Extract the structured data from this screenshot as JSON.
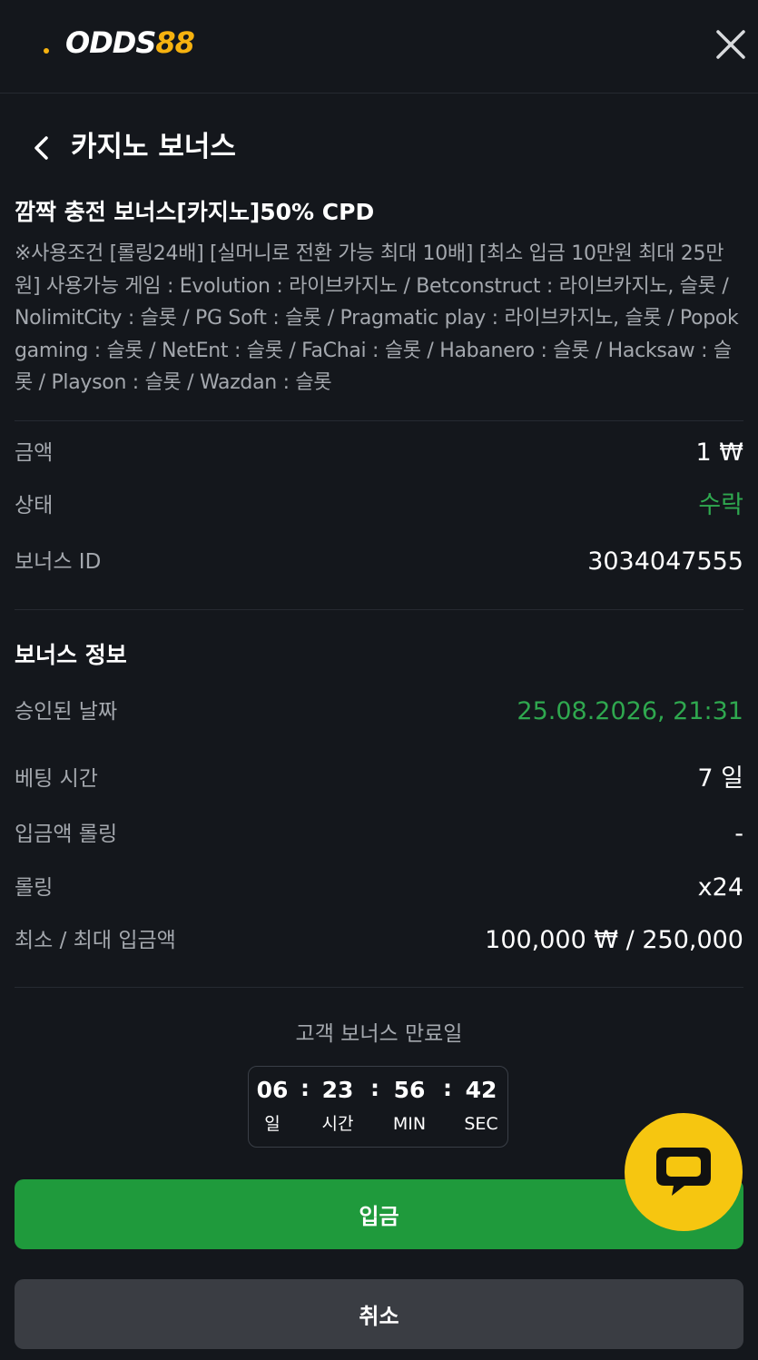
{
  "header": {
    "logo_white": "ODDS",
    "logo_accent": "88"
  },
  "page": {
    "title": "카지노 보너스"
  },
  "bonus": {
    "title": "깜짝 충전 보너스[카지노]50% CPD",
    "description": "※사용조건 [롤링24배] [실머니로 전환 가능 최대 10배] [최소 입금 10만원 최대 25만원] 사용가능 게임 : Evolution : 라이브카지노 / Betconstruct : 라이브카지노, 슬롯 / NolimitCity : 슬롯 / PG Soft : 슬롯 / Pragmatic play : 라이브카지노, 슬롯 / Popok gaming : 슬롯 / NetEnt : 슬롯 / FaChai : 슬롯 / Habanero : 슬롯 / Hacksaw : 슬롯 / Playson : 슬롯 / Wazdan : 슬롯"
  },
  "summary": {
    "amount_label": "금액",
    "amount_value": "1 ₩",
    "status_label": "상태",
    "status_value": "수락",
    "id_label": "보너스 ID",
    "id_value": "3034047555"
  },
  "info": {
    "title": "보너스 정보",
    "approved_label": "승인된 날짜",
    "approved_value": "25.08.2026, 21:31",
    "betting_label": "베팅 시간",
    "betting_value": "7 일",
    "deposit_rolling_label": "입금액 롤링",
    "deposit_rolling_value": "-",
    "rolling_label": "롤링",
    "rolling_value": "x24",
    "minmax_label": "최소 / 최대 입금액",
    "minmax_value": "100,000 ₩ / 250,000"
  },
  "expiry": {
    "label": "고객 보너스 만료일",
    "days": "06",
    "days_unit": "일",
    "hours": "23",
    "hours_unit": "시간",
    "minutes": "56",
    "minutes_unit": "MIN",
    "seconds": "42",
    "seconds_unit": "SEC"
  },
  "buttons": {
    "deposit": "입금",
    "cancel": "취소"
  },
  "colors": {
    "accent_yellow": "#f6b20f",
    "green": "#2fa84f",
    "deposit_green": "#1f9a3c",
    "background": "#14171c"
  }
}
